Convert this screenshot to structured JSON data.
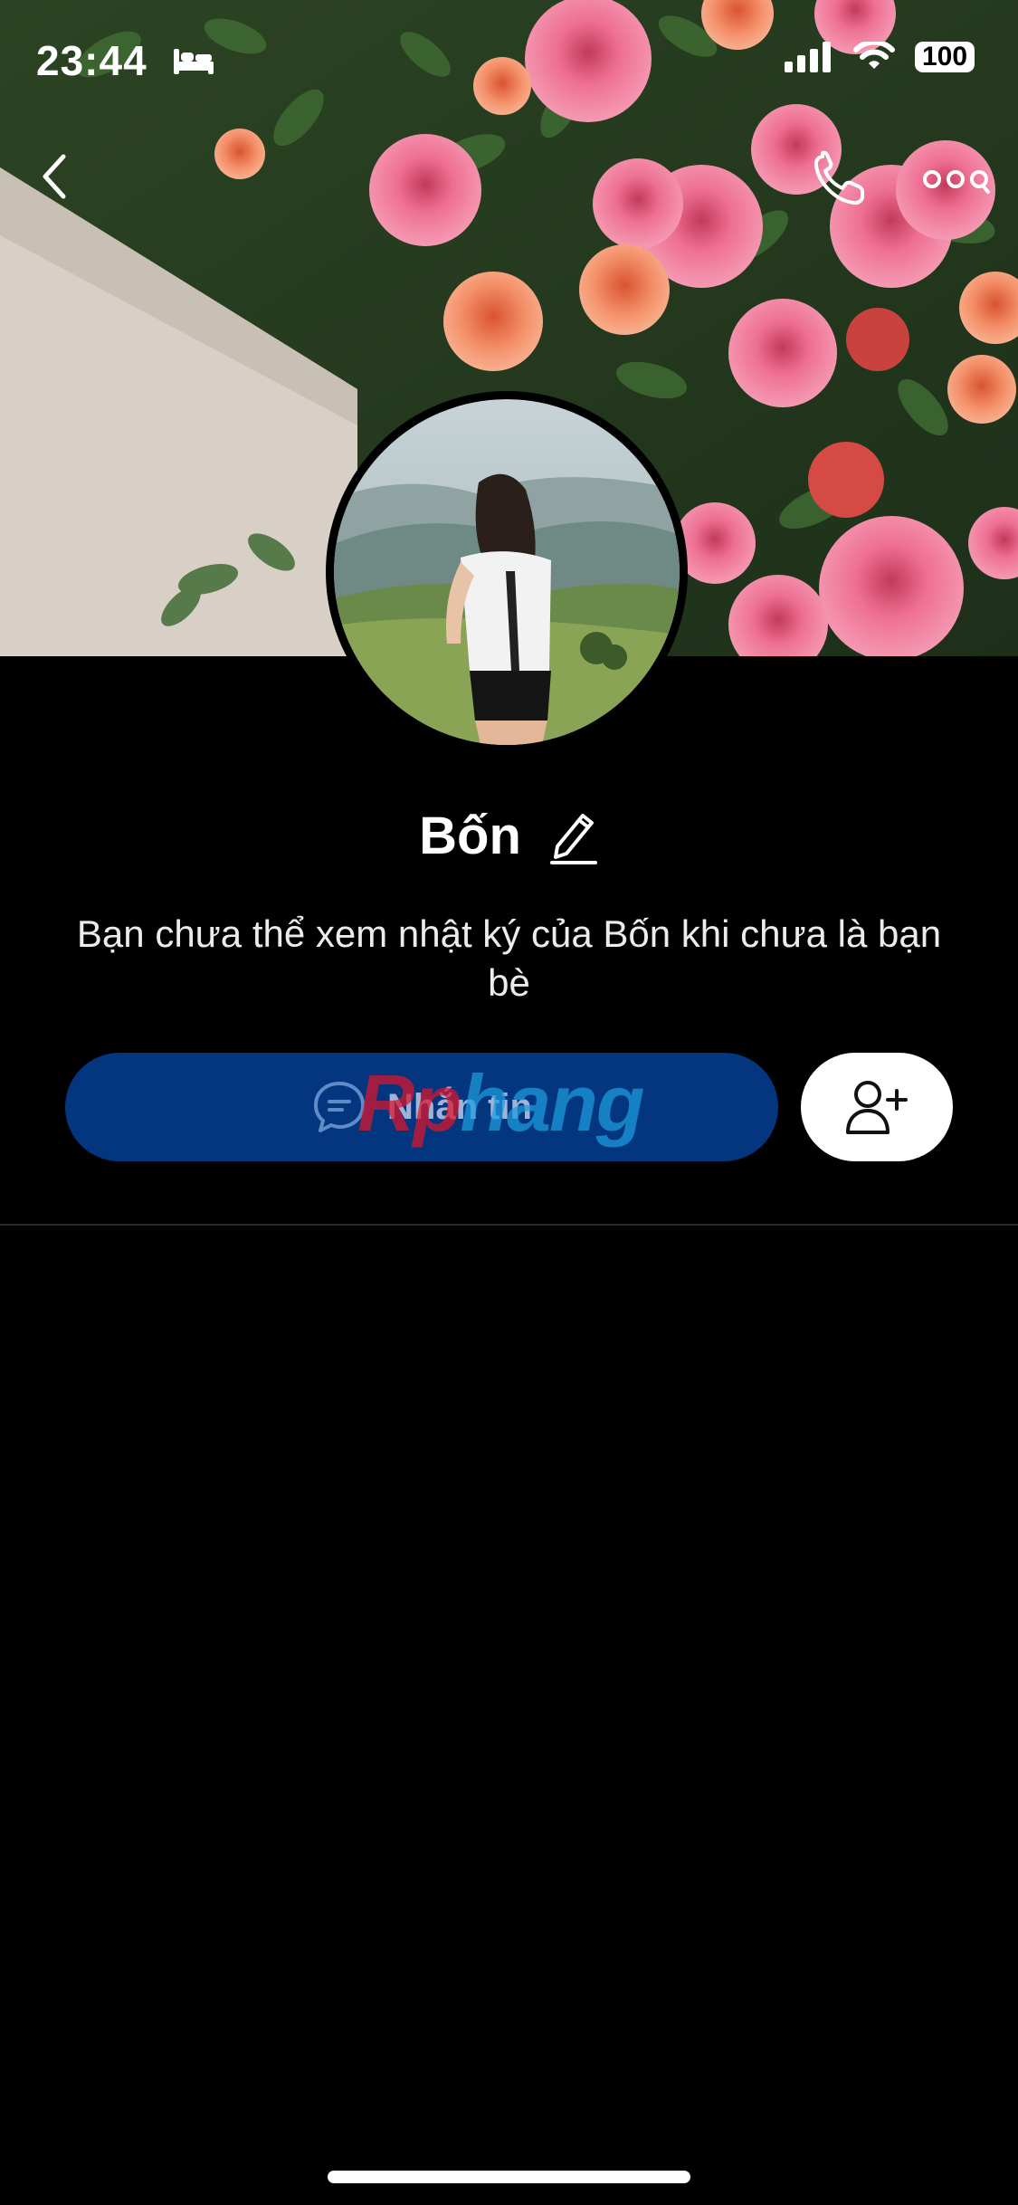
{
  "status_bar": {
    "time": "23:44",
    "battery": "100",
    "bed_icon": "bed-icon",
    "signal_icon": "cellular-signal-icon",
    "wifi_icon": "wifi-icon"
  },
  "nav": {
    "back_icon": "chevron-left-icon",
    "call_icon": "phone-icon",
    "more_icon": "more-dots-icon"
  },
  "profile": {
    "name": "Bốn",
    "edit_icon": "pencil-icon",
    "notice": "Bạn chưa thể xem nhật ký của Bốn khi chưa là bạn bè"
  },
  "actions": {
    "message_label": "Nhắn tin",
    "message_icon": "chat-bubble-icon",
    "add_friend_icon": "add-user-icon",
    "message_color": "#04367f"
  },
  "watermark": {
    "part1": "Rp",
    "part2": "hang"
  }
}
